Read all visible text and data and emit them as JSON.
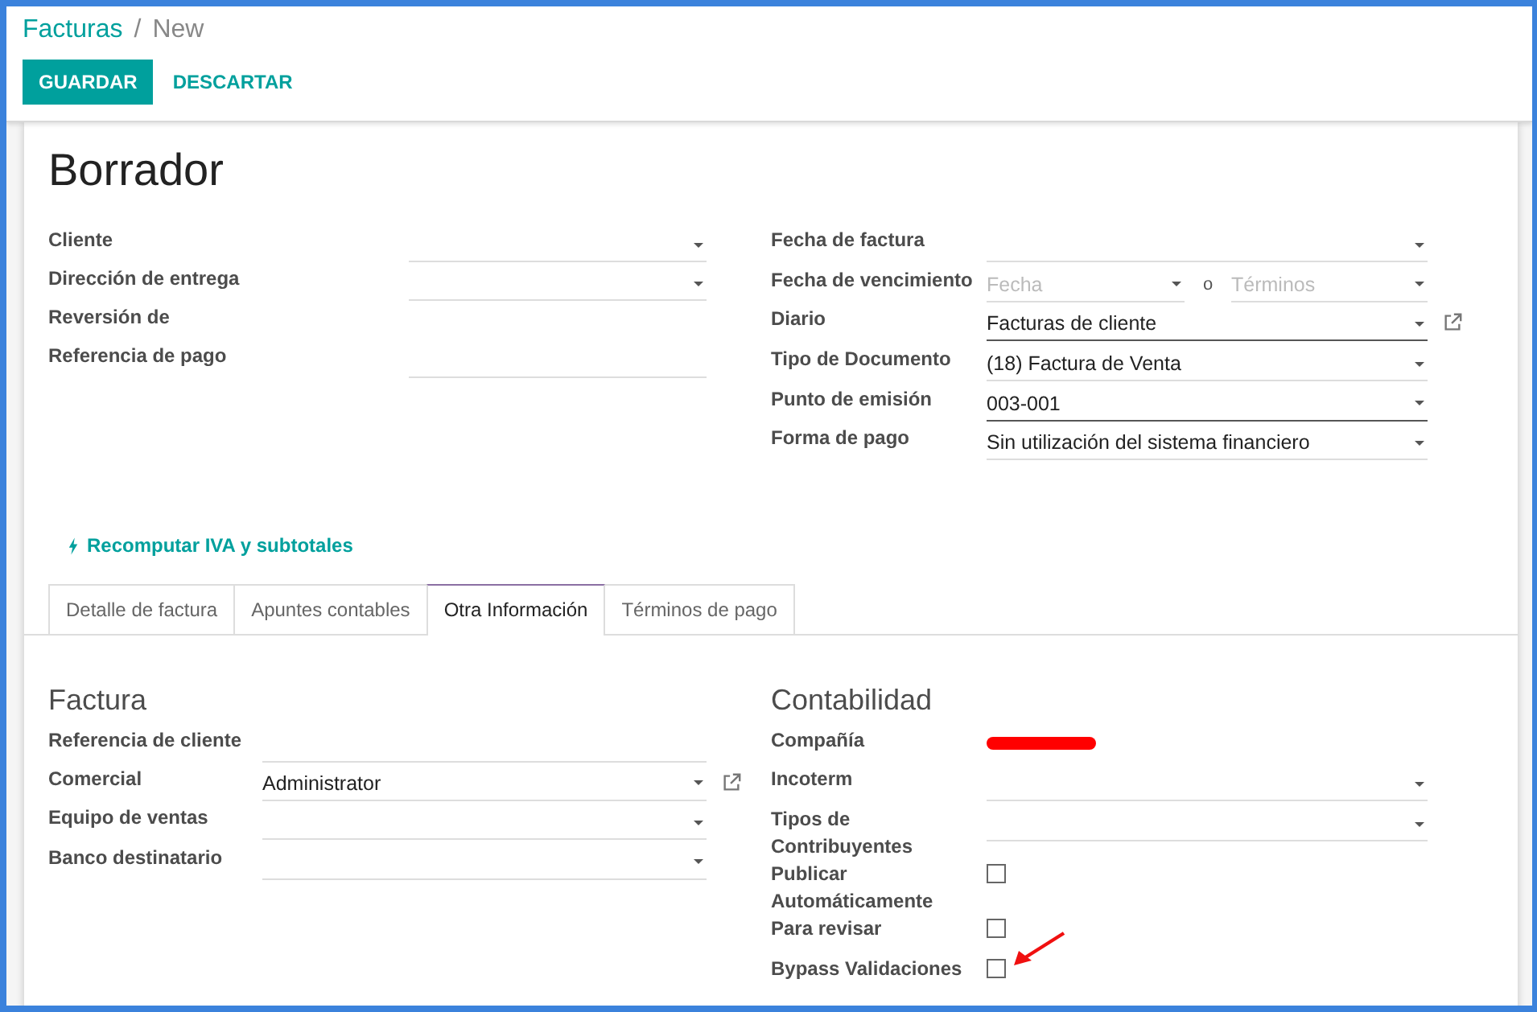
{
  "breadcrumb": {
    "parent": "Facturas",
    "separator": "/",
    "current": "New"
  },
  "buttons": [
    {
      "label": "GUARDAR",
      "kind": "primary"
    },
    {
      "label": "DESCARTAR",
      "kind": "link"
    }
  ],
  "sheet": {
    "status_title": "Borrador",
    "left_fields": [
      {
        "label": "Cliente",
        "kind": "select",
        "required": false
      },
      {
        "label": "Dirección de entrega",
        "kind": "select",
        "required": false
      },
      {
        "label": "Reversión de",
        "kind": "none"
      },
      {
        "label": "Referencia de pago",
        "kind": "text",
        "required": false
      }
    ],
    "right_fields": [
      {
        "label": "Fecha de factura",
        "kind": "select",
        "required": false
      },
      {
        "label": "Fecha de vencimiento",
        "kind": "date_pair",
        "placeholder": "Fecha",
        "separator": "o",
        "placeholder_2": "Términos",
        "required": false
      },
      {
        "label": "Diario",
        "kind": "select",
        "value": "Facturas de cliente",
        "required": true,
        "external_link": true
      },
      {
        "label": "Tipo de Documento",
        "kind": "select",
        "value": "(18) Factura de Venta",
        "required": false
      },
      {
        "label": "Punto de emisión",
        "kind": "select",
        "value": "003-001",
        "required": true
      },
      {
        "label": "Forma de pago",
        "kind": "select",
        "value": "Sin utilización del sistema financiero",
        "required": false
      }
    ],
    "action_link": "Recomputar IVA y subtotales",
    "tabs": [
      {
        "label": "Detalle de factura",
        "selected": false
      },
      {
        "label": "Apuntes contables",
        "selected": false
      },
      {
        "label": "Otra Información",
        "selected": true
      },
      {
        "label": "Términos de pago",
        "selected": false
      }
    ],
    "sections": [
      {
        "title": "Factura",
        "fields": [
          {
            "label": "Referencia de cliente",
            "kind": "text",
            "required": false
          },
          {
            "label": "Comercial",
            "kind": "select",
            "value": "Administrator",
            "required": false,
            "external_link": true
          },
          {
            "label": "Equipo de ventas",
            "kind": "select",
            "required": false
          },
          {
            "label": "Banco destinatario",
            "kind": "select",
            "required": false
          }
        ]
      },
      {
        "title": "Contabilidad",
        "fields": [
          {
            "label": "Compañía",
            "kind": "redacted"
          },
          {
            "label": "Incoterm",
            "kind": "select",
            "required": false
          },
          {
            "label": "Tipos de Contribuyentes",
            "kind": "select",
            "required": false
          },
          {
            "label": "Publicar Automáticamente",
            "kind": "checkbox",
            "checked": false
          },
          {
            "label": "Para revisar",
            "kind": "checkbox",
            "checked": false
          },
          {
            "label": "Bypass Validaciones",
            "kind": "checkbox",
            "checked": false,
            "annotated": true
          }
        ]
      }
    ]
  }
}
